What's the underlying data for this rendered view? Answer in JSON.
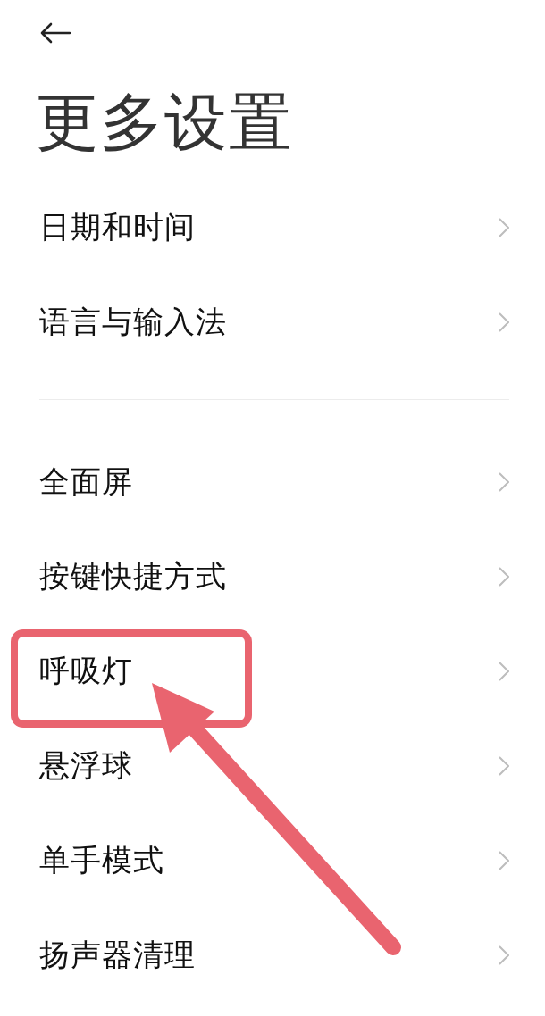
{
  "title": "更多设置",
  "sections": [
    {
      "items": [
        {
          "label": "日期和时间",
          "highlighted": false
        },
        {
          "label": "语言与输入法",
          "highlighted": false
        }
      ]
    },
    {
      "items": [
        {
          "label": "全面屏",
          "highlighted": false
        },
        {
          "label": "按键快捷方式",
          "highlighted": false
        },
        {
          "label": "呼吸灯",
          "highlighted": true
        },
        {
          "label": "悬浮球",
          "highlighted": false
        },
        {
          "label": "单手模式",
          "highlighted": false
        },
        {
          "label": "扬声器清理",
          "highlighted": false
        }
      ]
    }
  ]
}
